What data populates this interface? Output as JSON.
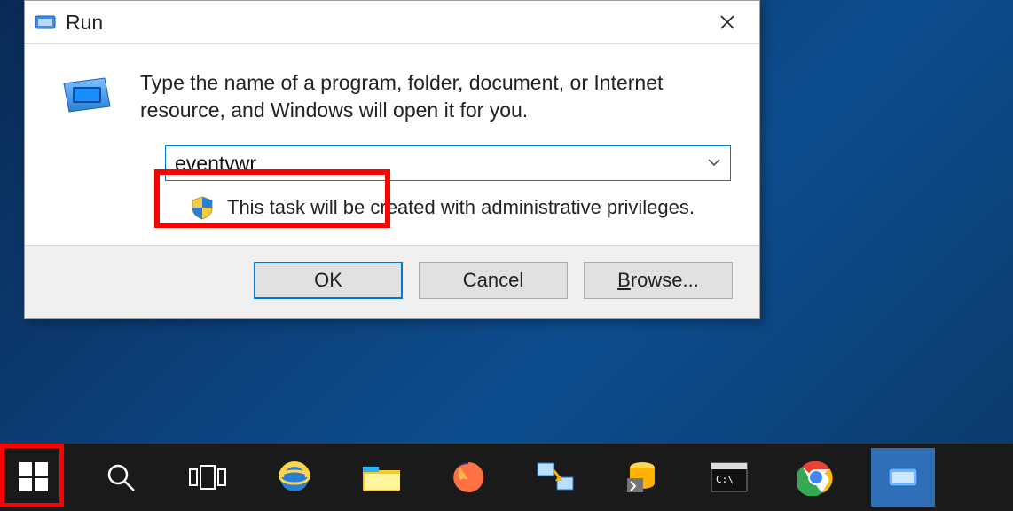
{
  "dialog": {
    "title": "Run",
    "instruction": "Type the name of a program, folder, document, or Internet resource, and Windows will open it for you.",
    "input_value": "eventvwr",
    "admin_text": "This task will be created with administrative privileges.",
    "buttons": {
      "ok": "OK",
      "cancel": "Cancel",
      "browse": "Browse..."
    }
  },
  "taskbar": {
    "items": [
      "start",
      "search",
      "task-view",
      "internet-explorer",
      "file-explorer",
      "firefox",
      "winscp",
      "ssms",
      "command-prompt",
      "chrome",
      "run"
    ]
  }
}
